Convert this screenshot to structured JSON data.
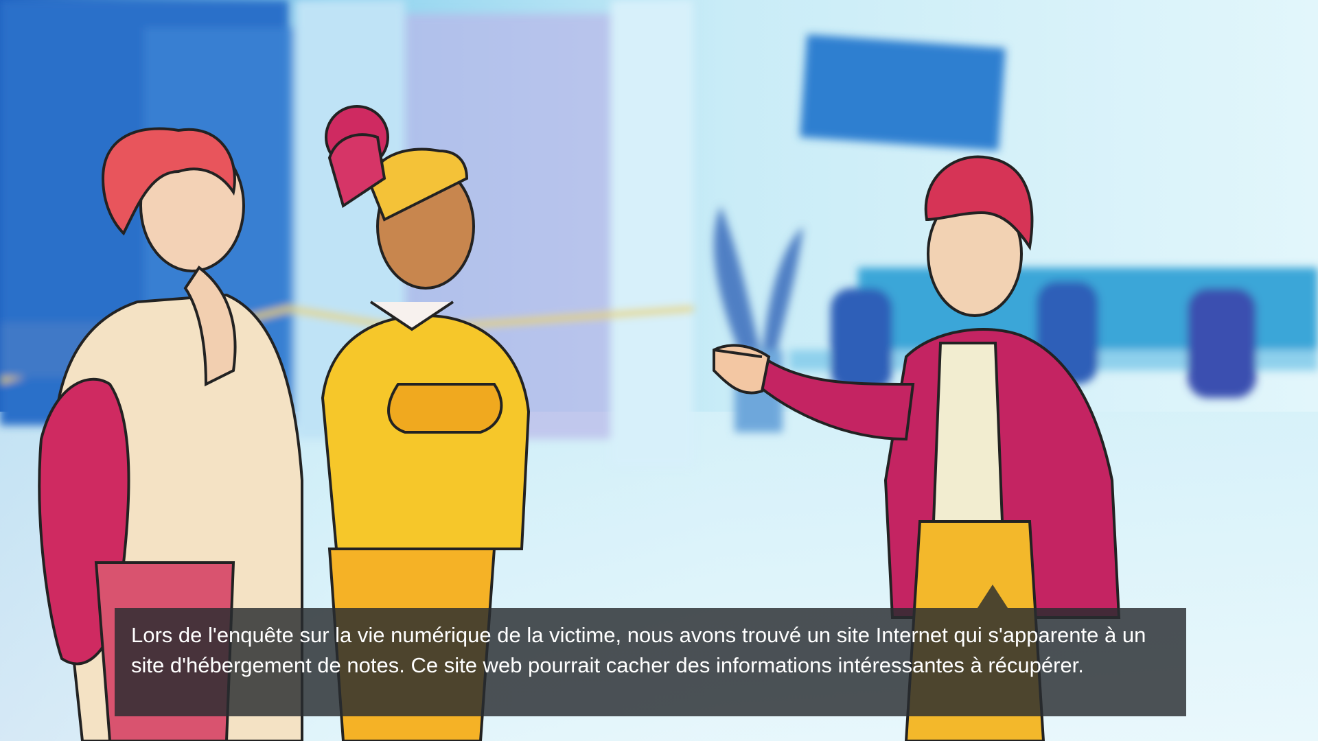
{
  "dialogue": {
    "text": "Lors de l'enquête sur la vie numérique de la victime, nous avons trouvé un site Internet qui s'apparente à un site d'hébergement de notes. Ce site web pourrait cacher des informations intéressantes à récupérer."
  },
  "colors": {
    "background_wall": "#cdeef7",
    "background_blue": "#2a6fc8",
    "jacket_magenta": "#c0205e",
    "sweater_yellow": "#f2b51a",
    "dialogue_box": "#282c30",
    "dialogue_text": "#ffffff"
  },
  "icons": {
    "advance_indicator": "triangle-up-icon"
  }
}
